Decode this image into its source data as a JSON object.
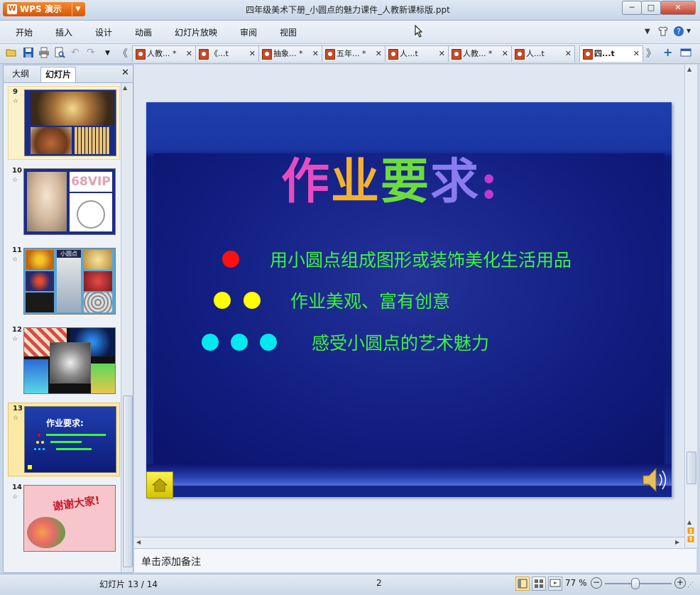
{
  "app": {
    "name": "WPS 演示",
    "dropdown_icon": "chevron-down-icon"
  },
  "window": {
    "title": "四年级美术下册_小圆点的魅力课件_人教新课标版.ppt",
    "minimize": "─",
    "maximize": "□",
    "close": "✕"
  },
  "menu": {
    "items": [
      "开始",
      "插入",
      "设计",
      "动画",
      "幻灯片放映",
      "审阅",
      "视图"
    ],
    "right_icons": [
      "chevron-down-icon",
      "shirt-icon",
      "help-icon"
    ]
  },
  "toolbar": {
    "icons": [
      "open-icon",
      "save-icon",
      "print-icon",
      "print-preview-icon",
      "undo-icon",
      "redo-icon",
      "dropdown-icon",
      "scroll-left-icon"
    ],
    "doc_tabs": [
      {
        "label": "人教... *",
        "close": "✕",
        "active": false
      },
      {
        "label": "《...t",
        "close": "✕",
        "active": false
      },
      {
        "label": "抽象... *",
        "close": "✕",
        "active": false
      },
      {
        "label": "五年... *",
        "close": "✕",
        "active": false
      },
      {
        "label": "人...t",
        "close": "✕",
        "active": false
      },
      {
        "label": "人教... *",
        "close": "✕",
        "active": false
      },
      {
        "label": "人...t",
        "close": "✕",
        "active": false
      },
      {
        "label": "四...t",
        "close": "✕",
        "active": true
      }
    ],
    "right_icons": [
      "scroll-right-icon",
      "new-tab-icon",
      "window-list-icon"
    ]
  },
  "left_panel": {
    "tabs": [
      "大纲",
      "幻灯片"
    ],
    "active_tab": "幻灯片",
    "close": "✕",
    "slides": [
      {
        "number": "9",
        "star": "☆",
        "selected": false
      },
      {
        "number": "10",
        "star": "☆",
        "selected": false
      },
      {
        "number": "11",
        "star": "☆",
        "selected": false
      },
      {
        "number": "12",
        "star": "☆",
        "selected": false
      },
      {
        "number": "13",
        "star": "☆",
        "selected": true
      },
      {
        "number": "14",
        "star": "☆",
        "selected": false
      }
    ],
    "thumb_texts": {
      "t10": "68VIP",
      "t11": "小圆点",
      "t13_title": "作业要求:",
      "t14": "谢谢大家!"
    }
  },
  "slide": {
    "title_chars": [
      "作",
      "业",
      "要",
      "求",
      ":"
    ],
    "bullets": [
      {
        "text": "用小圆点组成图形或装饰美化生活用品",
        "dot_count": 1,
        "dot_color": "#ff1010"
      },
      {
        "text": "作业美观、富有创意",
        "dot_count": 2,
        "dot_color": "#ffff00"
      },
      {
        "text": "感受小圆点的艺术魅力",
        "dot_count": 3,
        "dot_color": "#00e8f0"
      }
    ],
    "home_icon": "home-icon",
    "speaker_icon": "speaker-icon"
  },
  "notes": {
    "placeholder": "单击添加备注"
  },
  "status": {
    "slide_counter": "幻灯片 13 / 14",
    "middle": "2",
    "view_icons": [
      "normal-view-icon",
      "slide-sorter-icon",
      "slideshow-icon"
    ],
    "zoom": "77 %",
    "zoom_level": 0.77,
    "zoom_out": "−",
    "zoom_in": "+"
  }
}
